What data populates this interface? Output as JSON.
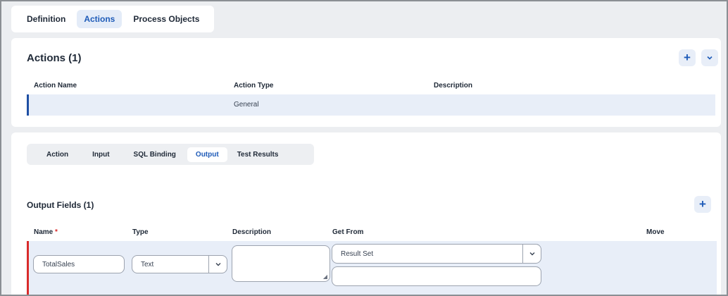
{
  "top_tabs": [
    {
      "label": "Definition"
    },
    {
      "label": "Actions"
    },
    {
      "label": "Process Objects"
    }
  ],
  "actions": {
    "title": "Actions (1)",
    "add_icon": "plus-icon",
    "expand_icon": "chevron-down-icon",
    "columns": {
      "name": "Action Name",
      "type": "Action Type",
      "description": "Description"
    },
    "rows": [
      {
        "name": "",
        "type": "General",
        "description": ""
      }
    ]
  },
  "sub_tabs": [
    {
      "label": "Action"
    },
    {
      "label": "Input"
    },
    {
      "label": "SQL Binding"
    },
    {
      "label": "Output"
    },
    {
      "label": "Test Results"
    }
  ],
  "output": {
    "title": "Output Fields (1)",
    "add_icon": "plus-icon",
    "columns": {
      "name": "Name",
      "required_mark": "*",
      "type": "Type",
      "description": "Description",
      "get_from": "Get From",
      "move": "Move"
    },
    "rows": [
      {
        "name": "TotalSales",
        "type": "Text",
        "description": "",
        "get_from": "Result Set",
        "get_from_detail": ""
      }
    ]
  },
  "colors": {
    "accent": "#1e5bb8",
    "row_highlight": "#e8eef8",
    "required": "#d92b2b"
  }
}
